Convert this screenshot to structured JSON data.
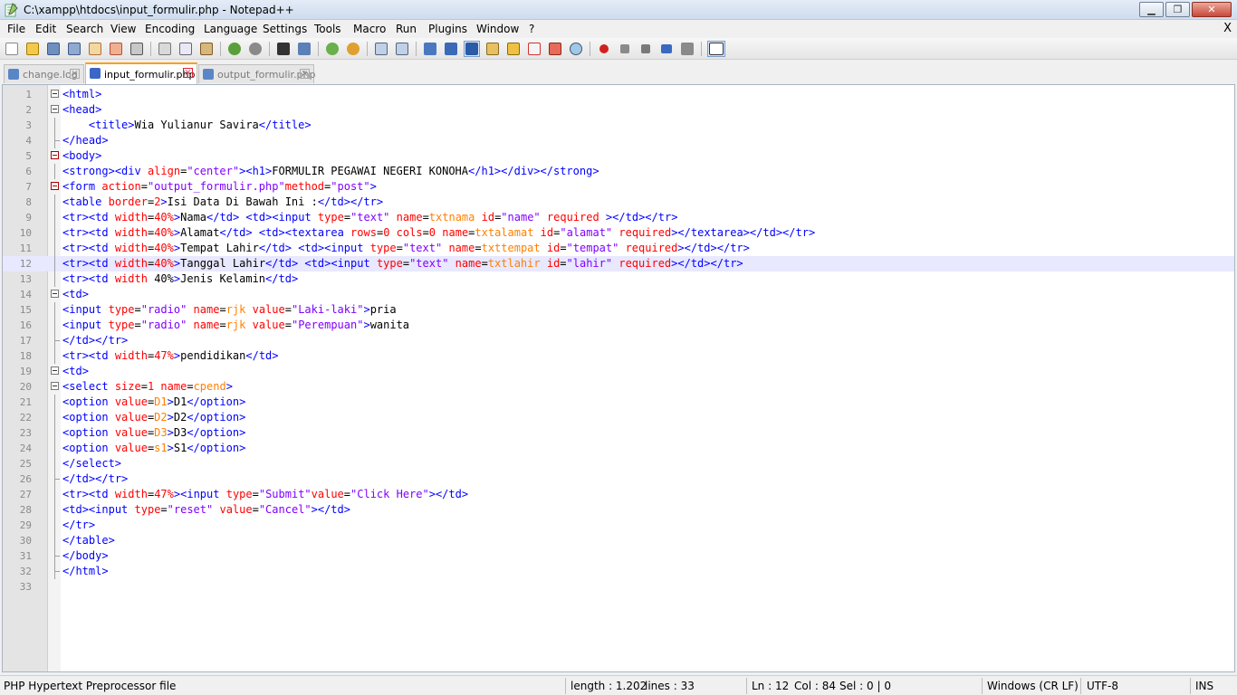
{
  "window": {
    "title": "C:\\xampp\\htdocs\\input_formulir.php - Notepad++"
  },
  "menu": [
    "File",
    "Edit",
    "Search",
    "View",
    "Encoding",
    "Language",
    "Settings",
    "Tools",
    "Macro",
    "Run",
    "Plugins",
    "Window",
    "?"
  ],
  "menu_close": "X",
  "tabs": [
    {
      "label": "change.log",
      "active": false
    },
    {
      "label": "input_formulir.php",
      "active": true
    },
    {
      "label": "output_formulir.php",
      "active": false
    }
  ],
  "editor": {
    "current_line": 12,
    "lines": [
      "<html>",
      "<head>",
      "    <title>Wia Yulianur Savira</title>",
      "</head>",
      "<body>",
      "<strong><div align=\"center\"><h1>FORMULIR PEGAWAI NEGERI KONOHA</h1></div></strong>",
      "<form action=\"output_formulir.php\"method=\"post\">",
      "<table border=2>Isi Data Di Bawah Ini :</td></tr>",
      "<tr><td width=40%>Nama</td> <td><input type=\"text\" name=txtnama id=\"name\" required ></td></tr>",
      "<tr><td width=40%>Alamat</td> <td><textarea rows=0 cols=0 name=txtalamat id=\"alamat\" required></textarea></td></tr>",
      "<tr><td width=40%>Tempat Lahir</td> <td><input type=\"text\" name=txttempat id=\"tempat\" required></td></tr>",
      "<tr><td width=40%>Tanggal Lahir</td> <td><input type=\"text\" name=txtlahir id=\"lahir\" required></td></tr>",
      "<tr><td width 40%>Jenis Kelamin</td>",
      "<td>",
      "<input type=\"radio\" name=rjk value=\"Laki-laki\">pria",
      "<input type=\"radio\" name=rjk value=\"Perempuan\">wanita",
      "</td></tr>",
      "<tr><td width=47%>pendidikan</td>",
      "<td>",
      "<select size=1 name=cpend>",
      "<option value=D1>D1</option>",
      "<option value=D2>D2</option>",
      "<option value=D3>D3</option>",
      "<option value=s1>S1</option>",
      "</select>",
      "</td></tr>",
      "<tr><td width=47%><input type=\"Submit\"value=\"Click Here\"></td>",
      "<td><input type=\"reset\" value=\"Cancel\"></td>",
      "</tr>",
      "</table>",
      "</body>",
      "</html>",
      ""
    ]
  },
  "status": {
    "file_type": "PHP Hypertext Preprocessor file",
    "length": "length : 1.202",
    "lines": "lines : 33",
    "ln": "Ln : 12",
    "col": "Col : 84",
    "sel": "Sel : 0 | 0",
    "eol": "Windows (CR LF)",
    "encoding": "UTF-8",
    "mode": "INS"
  },
  "colors": {
    "tag": "#0000ff",
    "attr": "#ff0000",
    "string": "#8000ff",
    "value": "#ff8000",
    "active_tab_accent": "#fa9f1e"
  },
  "icons": [
    "new-file-icon",
    "open-file-icon",
    "save-icon",
    "save-all-icon",
    "close-icon",
    "close-all-icon",
    "print-icon",
    "cut-icon",
    "copy-icon",
    "paste-icon",
    "undo-icon",
    "redo-icon",
    "find-icon",
    "replace-icon",
    "zoom-in-icon",
    "zoom-out-icon",
    "sync-v-icon",
    "sync-h-icon",
    "word-wrap-icon",
    "show-all-chars-icon",
    "indent-guide-icon",
    "udl-icon",
    "doc-map-icon",
    "function-list-icon",
    "folder-workspace-icon",
    "monitor-icon",
    "record-macro-icon",
    "stop-record-icon",
    "play-macro-icon",
    "run-macro-multiple-icon",
    "save-macro-icon",
    "spell-check-icon"
  ]
}
